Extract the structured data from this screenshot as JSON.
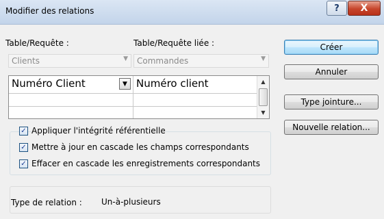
{
  "window": {
    "title": "Modifier des relations",
    "help_label": "?",
    "close_label": "X"
  },
  "table": {
    "label": "Table/Requête :",
    "value": "Clients"
  },
  "related_table": {
    "label": "Table/Requête liée :",
    "value": "Commandes"
  },
  "grid": {
    "rows": [
      {
        "left": "Numéro Client",
        "right": "Numéro client"
      },
      {
        "left": "",
        "right": ""
      },
      {
        "left": "",
        "right": ""
      }
    ]
  },
  "options": {
    "integrity": {
      "label": "Appliquer l'intégrité référentielle",
      "checked": true
    },
    "cascade_update": {
      "label": "Mettre à jour en cascade les champs correspondants",
      "checked": true
    },
    "cascade_delete": {
      "label": "Effacer en cascade les enregistrements correspondants",
      "checked": true
    },
    "check_mark": "✓"
  },
  "relation_type": {
    "label": "Type de relation :",
    "value": "Un-à-plusieurs"
  },
  "buttons": {
    "create": "Créer",
    "cancel": "Annuler",
    "join_type": "Type jointure...",
    "new_relation": "Nouvelle relation..."
  },
  "icons": {
    "dropdown_arrow": "▼",
    "scroll_up": "▲",
    "scroll_down": "▼"
  }
}
